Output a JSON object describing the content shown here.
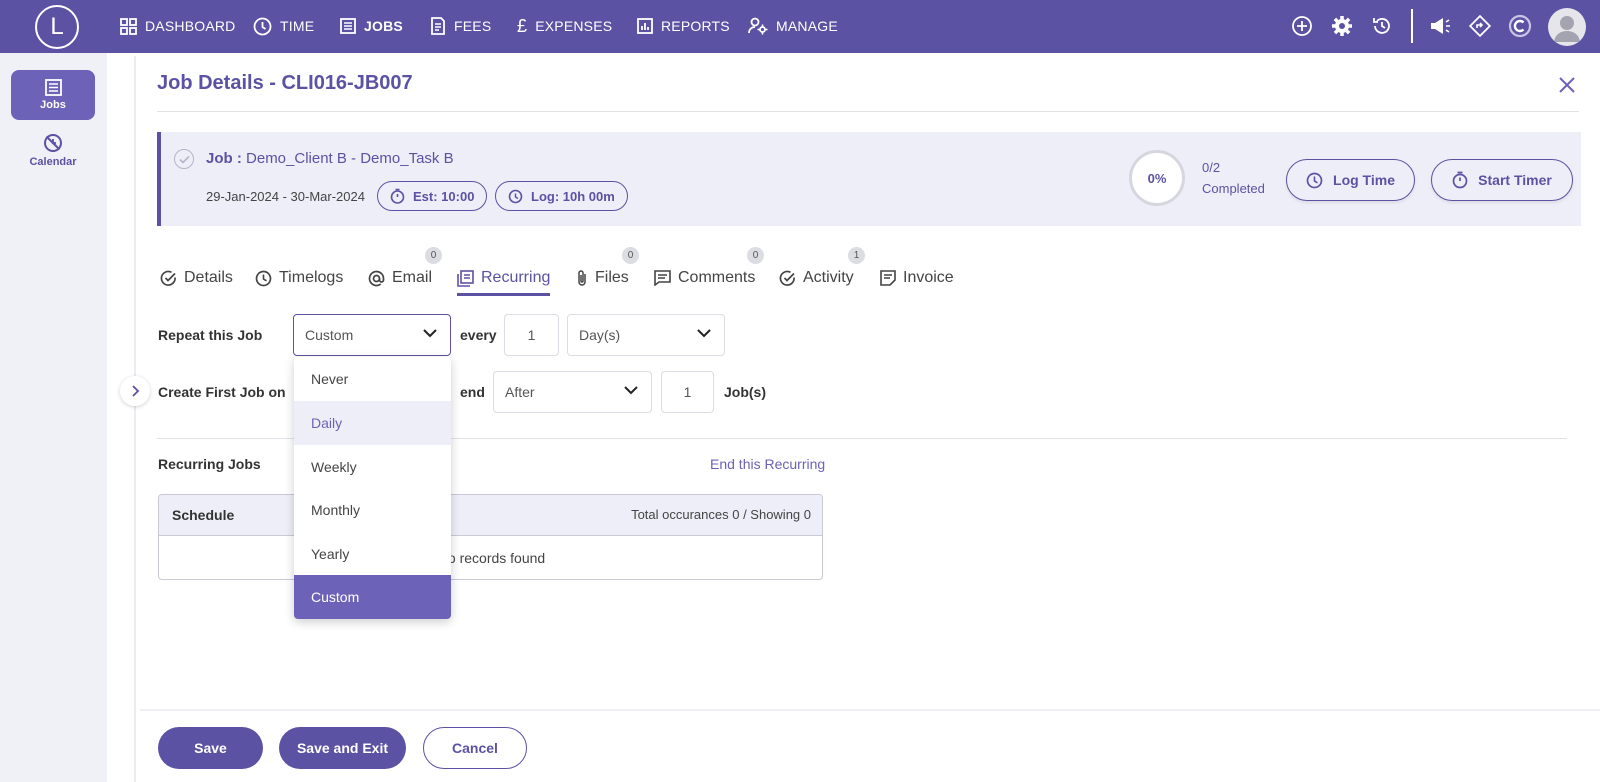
{
  "app": {
    "logo_letter": "L"
  },
  "nav": {
    "items": [
      {
        "label": "DASHBOARD",
        "icon": "grid-icon"
      },
      {
        "label": "TIME",
        "icon": "clock-icon"
      },
      {
        "label": "JOBS",
        "icon": "jobs-list-icon",
        "active": true
      },
      {
        "label": "FEES",
        "icon": "receipt-icon"
      },
      {
        "label": "EXPENSES",
        "icon": "pound-icon"
      },
      {
        "label": "REPORTS",
        "icon": "bar-chart-icon"
      },
      {
        "label": "MANAGE",
        "icon": "manage-icon"
      }
    ],
    "right_icons": [
      "add-circle-icon",
      "gear-icon",
      "history-icon",
      "megaphone-icon",
      "diamond-direction-icon",
      "c-brand-icon",
      "avatar"
    ]
  },
  "sidebar": {
    "items": [
      {
        "label": "Jobs",
        "icon": "jobs-list-icon",
        "active": true
      },
      {
        "label": "Calendar",
        "icon": "calendar-off-icon",
        "active": false
      }
    ]
  },
  "page": {
    "title": "Job Details - CLI016-JB007"
  },
  "job": {
    "label_prefix": "Job :",
    "name": "Demo_Client B - Demo_Task B",
    "dates": "29-Jan-2024 - 30-Mar-2024",
    "estimate": "Est: 10:00",
    "logged": "Log: 10h 00m",
    "progress_percent": "0%",
    "completed_count": "0/2",
    "completed_label": "Completed",
    "log_time_label": "Log Time",
    "start_timer_label": "Start Timer"
  },
  "tabs": [
    {
      "label": "Details",
      "icon": "check-circle-icon"
    },
    {
      "label": "Timelogs",
      "icon": "clock-icon"
    },
    {
      "label": "Email",
      "icon": "at-icon",
      "badge": "0"
    },
    {
      "label": "Recurring",
      "icon": "recurring-icon",
      "active": true
    },
    {
      "label": "Files",
      "icon": "paperclip-icon",
      "badge": "0"
    },
    {
      "label": "Comments",
      "icon": "comment-icon",
      "badge": "0"
    },
    {
      "label": "Activity",
      "icon": "check-circle-icon",
      "badge": "1"
    },
    {
      "label": "Invoice",
      "icon": "invoice-icon"
    }
  ],
  "recurring": {
    "repeat_label": "Repeat this Job",
    "repeat_value": "Custom",
    "every_label": "every",
    "every_value": "1",
    "unit_value": "Day(s)",
    "first_job_label": "Create First Job on",
    "end_label": "end",
    "end_value": "After",
    "end_count": "1",
    "jobs_suffix": "Job(s)",
    "dropdown_options": [
      "Never",
      "Daily",
      "Weekly",
      "Monthly",
      "Yearly",
      "Custom"
    ],
    "dropdown_hover": "Daily",
    "dropdown_selected": "Custom"
  },
  "recurring_jobs": {
    "title": "Recurring Jobs",
    "end_link": "End this Recurring",
    "table_header": "Schedule",
    "total_label": "Total occurances 0 / Showing 0",
    "empty_text": "No records found"
  },
  "footer": {
    "save_label": "Save",
    "save_exit_label": "Save and Exit",
    "cancel_label": "Cancel"
  },
  "colors": {
    "brand": "#5b52a3",
    "accent": "#6c62b8",
    "card_bg": "#eeeef8"
  }
}
